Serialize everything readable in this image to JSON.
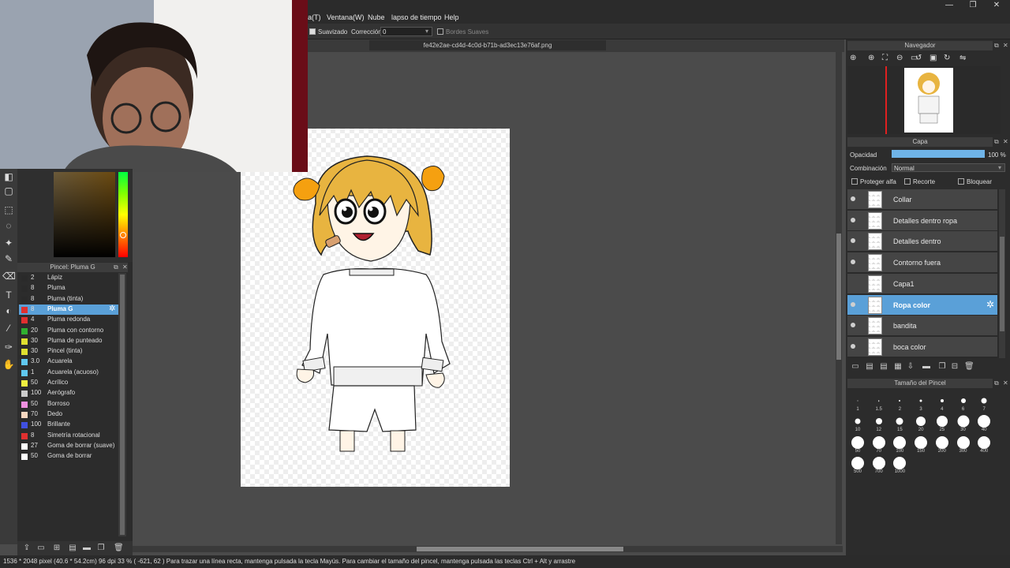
{
  "menubar": {
    "items": [
      "a(T)",
      "Ventana(W)",
      "Nube",
      "lapso de tiempo",
      "Help"
    ]
  },
  "window_controls": [
    "—",
    "❐",
    "✕"
  ],
  "tool_options": {
    "smoothing_label": "Suavizado",
    "correction_label": "Corrección",
    "correction_value": "0",
    "soft_edges_label": "Bordes Suaves"
  },
  "document": {
    "tab_title": "fe42e2ae-cd4d-4c0d-b71b-ad3ec13e76af.png"
  },
  "brush_panel": {
    "title": "Pincel: Pluma G",
    "items": [
      {
        "size": "2",
        "name": "Lápiz",
        "color": "#2a2a2a"
      },
      {
        "size": "8",
        "name": "Pluma",
        "color": "#2a2a2a"
      },
      {
        "size": "8",
        "name": "Pluma (tinta)",
        "color": "#2a2a2a"
      },
      {
        "size": "8",
        "name": "Pluma G",
        "color": "#e03030",
        "selected": true
      },
      {
        "size": "4",
        "name": "Pluma redonda",
        "color": "#e03030"
      },
      {
        "size": "20",
        "name": "Pluma con contorno",
        "color": "#30b030"
      },
      {
        "size": "30",
        "name": "Pluma de punteado",
        "color": "#e0e030"
      },
      {
        "size": "30",
        "name": "Pincel (tinta)",
        "color": "#e0e030"
      },
      {
        "size": "3.0",
        "name": "Acuarela",
        "color": "#60c8f0"
      },
      {
        "size": "1",
        "name": "Acuarela (acuoso)",
        "color": "#60c8f0"
      },
      {
        "size": "50",
        "name": "Acrílico",
        "color": "#f0f040"
      },
      {
        "size": "100",
        "name": "Aerógrafo",
        "color": "#cccccc"
      },
      {
        "size": "50",
        "name": "Borroso",
        "color": "#f090e0"
      },
      {
        "size": "70",
        "name": "Dedo",
        "color": "#f8d8c0"
      },
      {
        "size": "100",
        "name": "Brillante",
        "color": "#4050e0"
      },
      {
        "size": "8",
        "name": "Simetría rotacional",
        "color": "#e03030"
      },
      {
        "size": "27",
        "name": "Goma de borrar (suave)",
        "color": "#ffffff"
      },
      {
        "size": "50",
        "name": "Goma de borrar",
        "color": "#ffffff"
      }
    ]
  },
  "navigator": {
    "title": "Navegador"
  },
  "layers": {
    "title": "Capa",
    "opacity_label": "Opacidad",
    "opacity_value": "100 %",
    "opacity_fraction": 1.0,
    "blend_label": "Combinación",
    "blend_value": "Normal",
    "protect_alpha_label": "Proteger alfa",
    "clipping_label": "Recorte",
    "lock_label": "Bloquear",
    "items": [
      {
        "name": "Collar",
        "visible": true
      },
      {
        "name": "Detalles dentro ropa",
        "visible": true
      },
      {
        "name": "Detalles dentro",
        "visible": true
      },
      {
        "name": "Contorno fuera",
        "visible": true
      },
      {
        "name": "Capa1",
        "visible": false
      },
      {
        "name": "Ropa color",
        "visible": true,
        "selected": true
      },
      {
        "name": "bandita",
        "visible": true
      },
      {
        "name": "boca color",
        "visible": true
      }
    ]
  },
  "brush_size_panel": {
    "title": "Tamaño del Pincel",
    "sizes": [
      "1",
      "1.5",
      "2",
      "3",
      "4",
      "6",
      "7",
      "10",
      "12",
      "15",
      "20",
      "25",
      "30",
      "40",
      "50",
      "70",
      "100",
      "150",
      "200",
      "300",
      "400",
      "500",
      "700",
      "1000"
    ]
  },
  "status": {
    "text": "1536 * 2048 pixel   (40.6 * 54.2cm)   96 dpi   33 %   ( -621, 62 )   Para trazar una línea recta, mantenga pulsada la tecla Mayús. Para cambiar el tamaño del pincel, mantenga pulsada las teclas Ctrl + Alt y arrastre"
  },
  "colors": {
    "accent": "#5aa0d8",
    "panel_bg": "#2c2c2c",
    "canvas_bg": "#4b4b4b"
  }
}
